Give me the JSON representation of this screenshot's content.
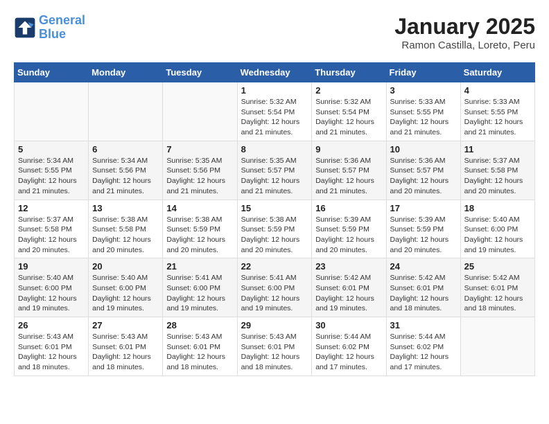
{
  "header": {
    "logo_line1": "General",
    "logo_line2": "Blue",
    "title": "January 2025",
    "subtitle": "Ramon Castilla, Loreto, Peru"
  },
  "weekdays": [
    "Sunday",
    "Monday",
    "Tuesday",
    "Wednesday",
    "Thursday",
    "Friday",
    "Saturday"
  ],
  "weeks": [
    [
      {
        "day": "",
        "info": ""
      },
      {
        "day": "",
        "info": ""
      },
      {
        "day": "",
        "info": ""
      },
      {
        "day": "1",
        "info": "Sunrise: 5:32 AM\nSunset: 5:54 PM\nDaylight: 12 hours and 21 minutes."
      },
      {
        "day": "2",
        "info": "Sunrise: 5:32 AM\nSunset: 5:54 PM\nDaylight: 12 hours and 21 minutes."
      },
      {
        "day": "3",
        "info": "Sunrise: 5:33 AM\nSunset: 5:55 PM\nDaylight: 12 hours and 21 minutes."
      },
      {
        "day": "4",
        "info": "Sunrise: 5:33 AM\nSunset: 5:55 PM\nDaylight: 12 hours and 21 minutes."
      }
    ],
    [
      {
        "day": "5",
        "info": "Sunrise: 5:34 AM\nSunset: 5:55 PM\nDaylight: 12 hours and 21 minutes."
      },
      {
        "day": "6",
        "info": "Sunrise: 5:34 AM\nSunset: 5:56 PM\nDaylight: 12 hours and 21 minutes."
      },
      {
        "day": "7",
        "info": "Sunrise: 5:35 AM\nSunset: 5:56 PM\nDaylight: 12 hours and 21 minutes."
      },
      {
        "day": "8",
        "info": "Sunrise: 5:35 AM\nSunset: 5:57 PM\nDaylight: 12 hours and 21 minutes."
      },
      {
        "day": "9",
        "info": "Sunrise: 5:36 AM\nSunset: 5:57 PM\nDaylight: 12 hours and 21 minutes."
      },
      {
        "day": "10",
        "info": "Sunrise: 5:36 AM\nSunset: 5:57 PM\nDaylight: 12 hours and 20 minutes."
      },
      {
        "day": "11",
        "info": "Sunrise: 5:37 AM\nSunset: 5:58 PM\nDaylight: 12 hours and 20 minutes."
      }
    ],
    [
      {
        "day": "12",
        "info": "Sunrise: 5:37 AM\nSunset: 5:58 PM\nDaylight: 12 hours and 20 minutes."
      },
      {
        "day": "13",
        "info": "Sunrise: 5:38 AM\nSunset: 5:58 PM\nDaylight: 12 hours and 20 minutes."
      },
      {
        "day": "14",
        "info": "Sunrise: 5:38 AM\nSunset: 5:59 PM\nDaylight: 12 hours and 20 minutes."
      },
      {
        "day": "15",
        "info": "Sunrise: 5:38 AM\nSunset: 5:59 PM\nDaylight: 12 hours and 20 minutes."
      },
      {
        "day": "16",
        "info": "Sunrise: 5:39 AM\nSunset: 5:59 PM\nDaylight: 12 hours and 20 minutes."
      },
      {
        "day": "17",
        "info": "Sunrise: 5:39 AM\nSunset: 5:59 PM\nDaylight: 12 hours and 20 minutes."
      },
      {
        "day": "18",
        "info": "Sunrise: 5:40 AM\nSunset: 6:00 PM\nDaylight: 12 hours and 19 minutes."
      }
    ],
    [
      {
        "day": "19",
        "info": "Sunrise: 5:40 AM\nSunset: 6:00 PM\nDaylight: 12 hours and 19 minutes."
      },
      {
        "day": "20",
        "info": "Sunrise: 5:40 AM\nSunset: 6:00 PM\nDaylight: 12 hours and 19 minutes."
      },
      {
        "day": "21",
        "info": "Sunrise: 5:41 AM\nSunset: 6:00 PM\nDaylight: 12 hours and 19 minutes."
      },
      {
        "day": "22",
        "info": "Sunrise: 5:41 AM\nSunset: 6:00 PM\nDaylight: 12 hours and 19 minutes."
      },
      {
        "day": "23",
        "info": "Sunrise: 5:42 AM\nSunset: 6:01 PM\nDaylight: 12 hours and 19 minutes."
      },
      {
        "day": "24",
        "info": "Sunrise: 5:42 AM\nSunset: 6:01 PM\nDaylight: 12 hours and 18 minutes."
      },
      {
        "day": "25",
        "info": "Sunrise: 5:42 AM\nSunset: 6:01 PM\nDaylight: 12 hours and 18 minutes."
      }
    ],
    [
      {
        "day": "26",
        "info": "Sunrise: 5:43 AM\nSunset: 6:01 PM\nDaylight: 12 hours and 18 minutes."
      },
      {
        "day": "27",
        "info": "Sunrise: 5:43 AM\nSunset: 6:01 PM\nDaylight: 12 hours and 18 minutes."
      },
      {
        "day": "28",
        "info": "Sunrise: 5:43 AM\nSunset: 6:01 PM\nDaylight: 12 hours and 18 minutes."
      },
      {
        "day": "29",
        "info": "Sunrise: 5:43 AM\nSunset: 6:01 PM\nDaylight: 12 hours and 18 minutes."
      },
      {
        "day": "30",
        "info": "Sunrise: 5:44 AM\nSunset: 6:02 PM\nDaylight: 12 hours and 17 minutes."
      },
      {
        "day": "31",
        "info": "Sunrise: 5:44 AM\nSunset: 6:02 PM\nDaylight: 12 hours and 17 minutes."
      },
      {
        "day": "",
        "info": ""
      }
    ]
  ]
}
